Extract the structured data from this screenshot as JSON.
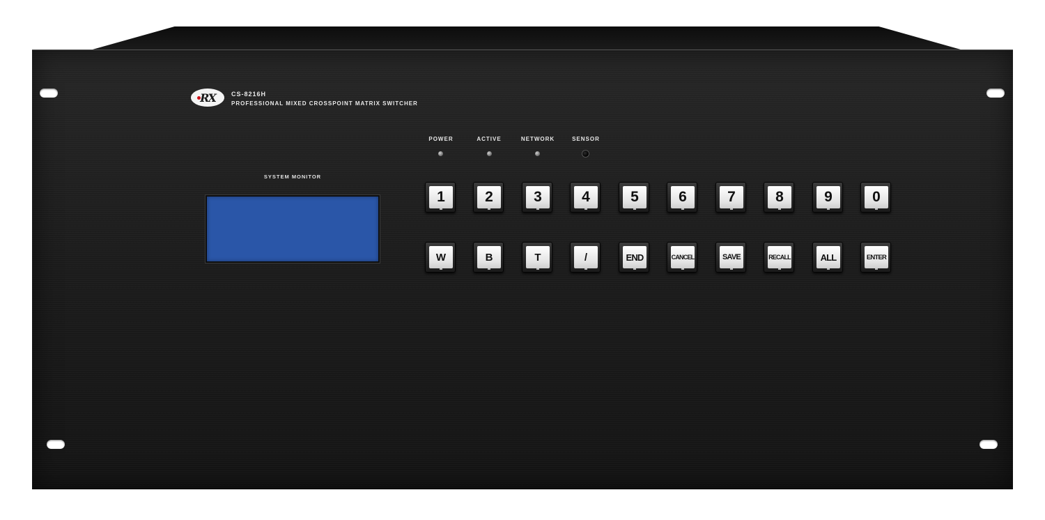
{
  "device": {
    "logo_text": "RX",
    "model": "CS-8216H",
    "subtitle": "PROFESSIONAL MIXED CROSSPOINT MATRIX SWITCHER",
    "monitor_label": "SYSTEM MONITOR"
  },
  "indicators": {
    "power": "POWER",
    "active": "ACTIVE",
    "network": "NETWORK",
    "sensor": "SENSOR"
  },
  "keypad": {
    "row1": [
      "1",
      "2",
      "3",
      "4",
      "5",
      "6",
      "7",
      "8",
      "9",
      "0"
    ],
    "row2": [
      "W",
      "B",
      "T",
      "/",
      "END",
      "CANCEL",
      "SAVE",
      "RECALL",
      "ALL",
      "ENTER"
    ]
  },
  "colors": {
    "panel": "#1e1e1e",
    "lcd": "#2a56a8",
    "logo_accent": "#d1121b"
  }
}
